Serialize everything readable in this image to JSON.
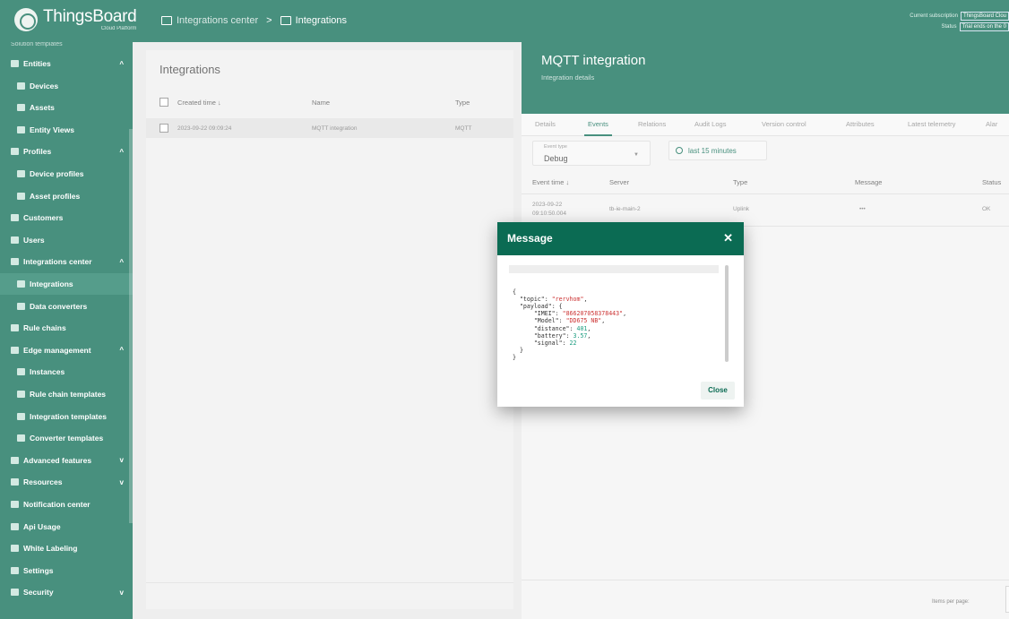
{
  "app": {
    "logo_name": "ThingsBoard",
    "logo_sub": "Cloud Platform"
  },
  "breadcrumb": {
    "parent": "Integrations center",
    "separator": ">",
    "current": "Integrations"
  },
  "subscription": {
    "line1_label": "Current subscription",
    "line1_value": "ThingsBoard Clou",
    "line2_label": "Status",
    "line2_value": "Trial ends on the 0"
  },
  "sidebar": {
    "top_partial": "Solution templates",
    "items": [
      {
        "label": "Entities",
        "chevron": "^",
        "child": false,
        "active": false
      },
      {
        "label": "Devices",
        "chevron": "",
        "child": true,
        "active": false
      },
      {
        "label": "Assets",
        "chevron": "",
        "child": true,
        "active": false
      },
      {
        "label": "Entity Views",
        "chevron": "",
        "child": true,
        "active": false
      },
      {
        "label": "Profiles",
        "chevron": "^",
        "child": false,
        "active": false
      },
      {
        "label": "Device profiles",
        "chevron": "",
        "child": true,
        "active": false
      },
      {
        "label": "Asset profiles",
        "chevron": "",
        "child": true,
        "active": false
      },
      {
        "label": "Customers",
        "chevron": "",
        "child": false,
        "active": false
      },
      {
        "label": "Users",
        "chevron": "",
        "child": false,
        "active": false
      },
      {
        "label": "Integrations center",
        "chevron": "^",
        "child": false,
        "active": false
      },
      {
        "label": "Integrations",
        "chevron": "",
        "child": true,
        "active": true
      },
      {
        "label": "Data converters",
        "chevron": "",
        "child": true,
        "active": false
      },
      {
        "label": "Rule chains",
        "chevron": "",
        "child": false,
        "active": false
      },
      {
        "label": "Edge management",
        "chevron": "^",
        "child": false,
        "active": false
      },
      {
        "label": "Instances",
        "chevron": "",
        "child": true,
        "active": false
      },
      {
        "label": "Rule chain templates",
        "chevron": "",
        "child": true,
        "active": false
      },
      {
        "label": "Integration templates",
        "chevron": "",
        "child": true,
        "active": false
      },
      {
        "label": "Converter templates",
        "chevron": "",
        "child": true,
        "active": false
      },
      {
        "label": "Advanced features",
        "chevron": "v",
        "child": false,
        "active": false
      },
      {
        "label": "Resources",
        "chevron": "v",
        "child": false,
        "active": false
      },
      {
        "label": "Notification center",
        "chevron": "",
        "child": false,
        "active": false
      },
      {
        "label": "Api Usage",
        "chevron": "",
        "child": false,
        "active": false
      },
      {
        "label": "White Labeling",
        "chevron": "",
        "child": false,
        "active": false
      },
      {
        "label": "Settings",
        "chevron": "",
        "child": false,
        "active": false
      },
      {
        "label": "Security",
        "chevron": "v",
        "child": false,
        "active": false
      }
    ]
  },
  "integrations": {
    "title": "Integrations",
    "columns": {
      "time": "Created time ↓",
      "name": "Name",
      "type": "Type"
    },
    "rows": [
      {
        "time": "2023-09-22 09:09:24",
        "name": "MQTT integration",
        "type": "MQTT"
      }
    ]
  },
  "details": {
    "title": "MQTT integration",
    "subtitle": "Integration details",
    "tabs": [
      "Details",
      "Events",
      "Relations",
      "Audit Logs",
      "Version control",
      "Attributes",
      "Latest telemetry",
      "Alar"
    ],
    "active_tab": "Events",
    "event_type_label": "Event type",
    "event_type_value": "Debug",
    "event_type_arrow": "▼",
    "period": "last 15 minutes",
    "columns": {
      "time": "Event time ↓",
      "server": "Server",
      "type": "Type",
      "message": "Message",
      "status": "Status"
    },
    "row": {
      "time_date": "2023-09-22",
      "time_clock": "09:10:50.004",
      "server": "tb-ie-main-2",
      "type": "Uplink",
      "message": "•••",
      "status": "OK"
    },
    "items_per_page": "Items per page:"
  },
  "modal": {
    "title": "Message",
    "close_x": "✕",
    "close_button": "Close",
    "code": {
      "open": "{",
      "topic_key": "\"topic\"",
      "topic_val": "\"rervhom\"",
      "payload_key": "\"payload\"",
      "imei_key": "\"IMEI\"",
      "imei_val": "\"866207058378443\"",
      "model_key": "\"Model\"",
      "model_val": "\"DD675 NB\"",
      "distance_key": "\"distance\"",
      "distance_val": "401",
      "battery_key": "\"battery\"",
      "battery_val": "3.57",
      "signal_key": "\"signal\"",
      "signal_val": "22",
      "inner_close": "}",
      "close": "}"
    }
  },
  "colors": {
    "brand": "#0b6b53",
    "accent": "#1d7d64",
    "json_string": "#cc3333",
    "json_number": "#1a9c7f"
  }
}
